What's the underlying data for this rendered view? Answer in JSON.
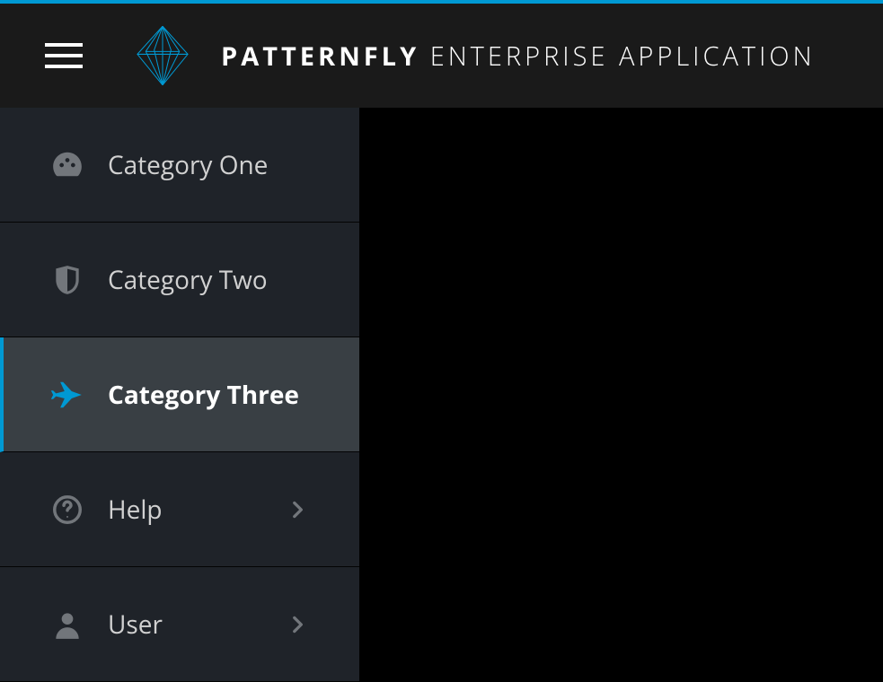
{
  "brand": {
    "name_bold": "PATTERNFLY",
    "name_light": "ENTERPRISE APPLICATION"
  },
  "colors": {
    "accent": "#0099d3",
    "sidebar_bg": "#1f2329",
    "active_bg": "#393f44",
    "icon_muted": "#72767b",
    "text_muted": "#d1d1d1"
  },
  "sidebar": {
    "items": [
      {
        "label": "Category One",
        "icon": "dashboard-icon",
        "active": false,
        "has_submenu": false
      },
      {
        "label": "Category Two",
        "icon": "shield-icon",
        "active": false,
        "has_submenu": false
      },
      {
        "label": "Category Three",
        "icon": "plane-icon",
        "active": true,
        "has_submenu": false
      },
      {
        "label": "Help",
        "icon": "help-icon",
        "active": false,
        "has_submenu": true
      },
      {
        "label": "User",
        "icon": "user-icon",
        "active": false,
        "has_submenu": true
      }
    ]
  }
}
